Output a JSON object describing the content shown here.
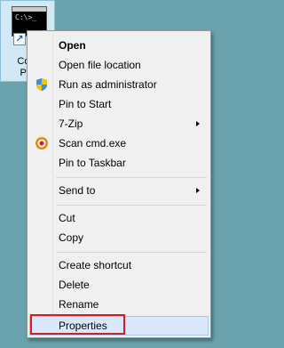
{
  "desktop": {
    "shortcut_prompt": "C:\\>_",
    "shortcut_label_line1": "Com",
    "shortcut_label_line2": "Pro"
  },
  "menu": {
    "items": [
      {
        "label": "Open",
        "bold": true
      },
      {
        "label": "Open file location"
      },
      {
        "label": "Run as administrator",
        "icon": "uac-shield-icon"
      },
      {
        "label": "Pin to Start"
      },
      {
        "label": "7-Zip",
        "submenu": true
      },
      {
        "label": "Scan cmd.exe",
        "icon": "antivirus-icon"
      },
      {
        "label": "Pin to Taskbar"
      },
      {
        "label": "Send to",
        "submenu": true
      },
      {
        "label": "Cut"
      },
      {
        "label": "Copy"
      },
      {
        "label": "Create shortcut"
      },
      {
        "label": "Delete"
      },
      {
        "label": "Rename"
      },
      {
        "label": "Properties",
        "highlighted": true
      }
    ]
  },
  "colors": {
    "highlight": "#d9e9fb",
    "focus_outline": "#e0191f",
    "desktop": "#6aa3ad"
  }
}
